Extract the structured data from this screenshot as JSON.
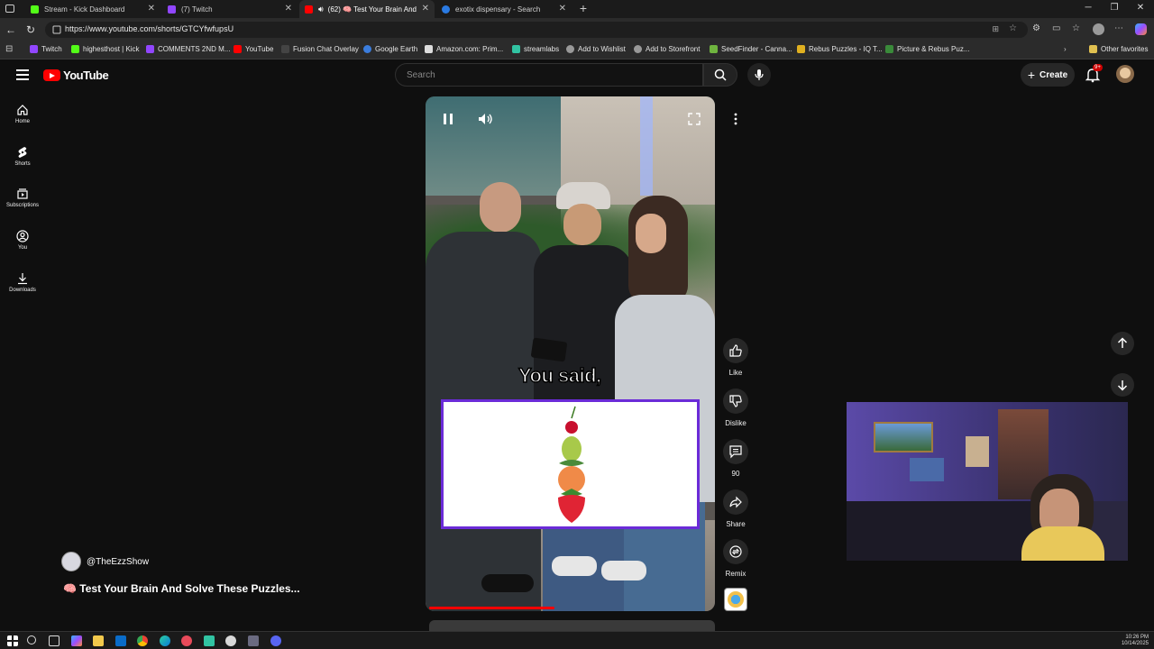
{
  "browser": {
    "tabs": [
      {
        "title": "Stream - Kick Dashboard",
        "color": "#53fc18"
      },
      {
        "title": "(7) Twitch",
        "color": "#9146ff"
      },
      {
        "title": "(62) 🧠 Test Your Brain And",
        "color": "#ff0000"
      },
      {
        "title": "exotix dispensary - Search",
        "color": "#2a7ae2"
      }
    ],
    "url": "https://www.youtube.com/shorts/GTCYfwfupsU",
    "bookmarks": [
      {
        "label": "Twitch",
        "color": "#9146ff"
      },
      {
        "label": "highesthost | Kick",
        "color": "#53fc18"
      },
      {
        "label": "COMMENTS 2ND M...",
        "color": "#9146ff"
      },
      {
        "label": "YouTube",
        "color": "#ff0000"
      },
      {
        "label": "Fusion Chat Overlay",
        "color": "#444444"
      },
      {
        "label": "Google Earth",
        "color": "#3b7ddd"
      },
      {
        "label": "Amazon.com: Prim...",
        "color": "#dddddd"
      },
      {
        "label": "streamlabs",
        "color": "#31c3a2"
      },
      {
        "label": "Add to Wishlist",
        "color": "#999999"
      },
      {
        "label": "Add to Storefront",
        "color": "#999999"
      },
      {
        "label": "SeedFinder - Canna...",
        "color": "#6fb43f"
      },
      {
        "label": "Rebus Puzzles - IQ T...",
        "color": "#e0b020"
      },
      {
        "label": "Picture & Rebus Puz...",
        "color": "#3a8a3a"
      }
    ],
    "other_favorites": "Other favorites"
  },
  "youtube": {
    "logo_text": "YouTube",
    "search_placeholder": "Search",
    "create_label": "Create",
    "notifications_badge": "9+",
    "sidebar": [
      {
        "label": "Home",
        "icon": "home-icon"
      },
      {
        "label": "Shorts",
        "icon": "shorts-icon"
      },
      {
        "label": "Subscriptions",
        "icon": "subscriptions-icon"
      },
      {
        "label": "You",
        "icon": "you-icon"
      },
      {
        "label": "Downloads",
        "icon": "downloads-icon"
      }
    ],
    "short": {
      "caption": "You said,",
      "channel": "@TheEzzShow",
      "title": "🧠 Test Your Brain And Solve These Puzzles...",
      "progress": 0.44
    },
    "actions": [
      {
        "label": "Like",
        "icon": "thumbs-up-icon"
      },
      {
        "label": "Dislike",
        "icon": "thumbs-down-icon"
      },
      {
        "label": "90",
        "icon": "comment-icon"
      },
      {
        "label": "Share",
        "icon": "share-icon"
      },
      {
        "label": "Remix",
        "icon": "remix-icon"
      }
    ]
  },
  "taskbar": {
    "time": "10:26 PM",
    "date": "10/14/2025"
  },
  "colors": {
    "accent_red": "#ff0000",
    "puzzle_border": "#6b2bd8"
  }
}
